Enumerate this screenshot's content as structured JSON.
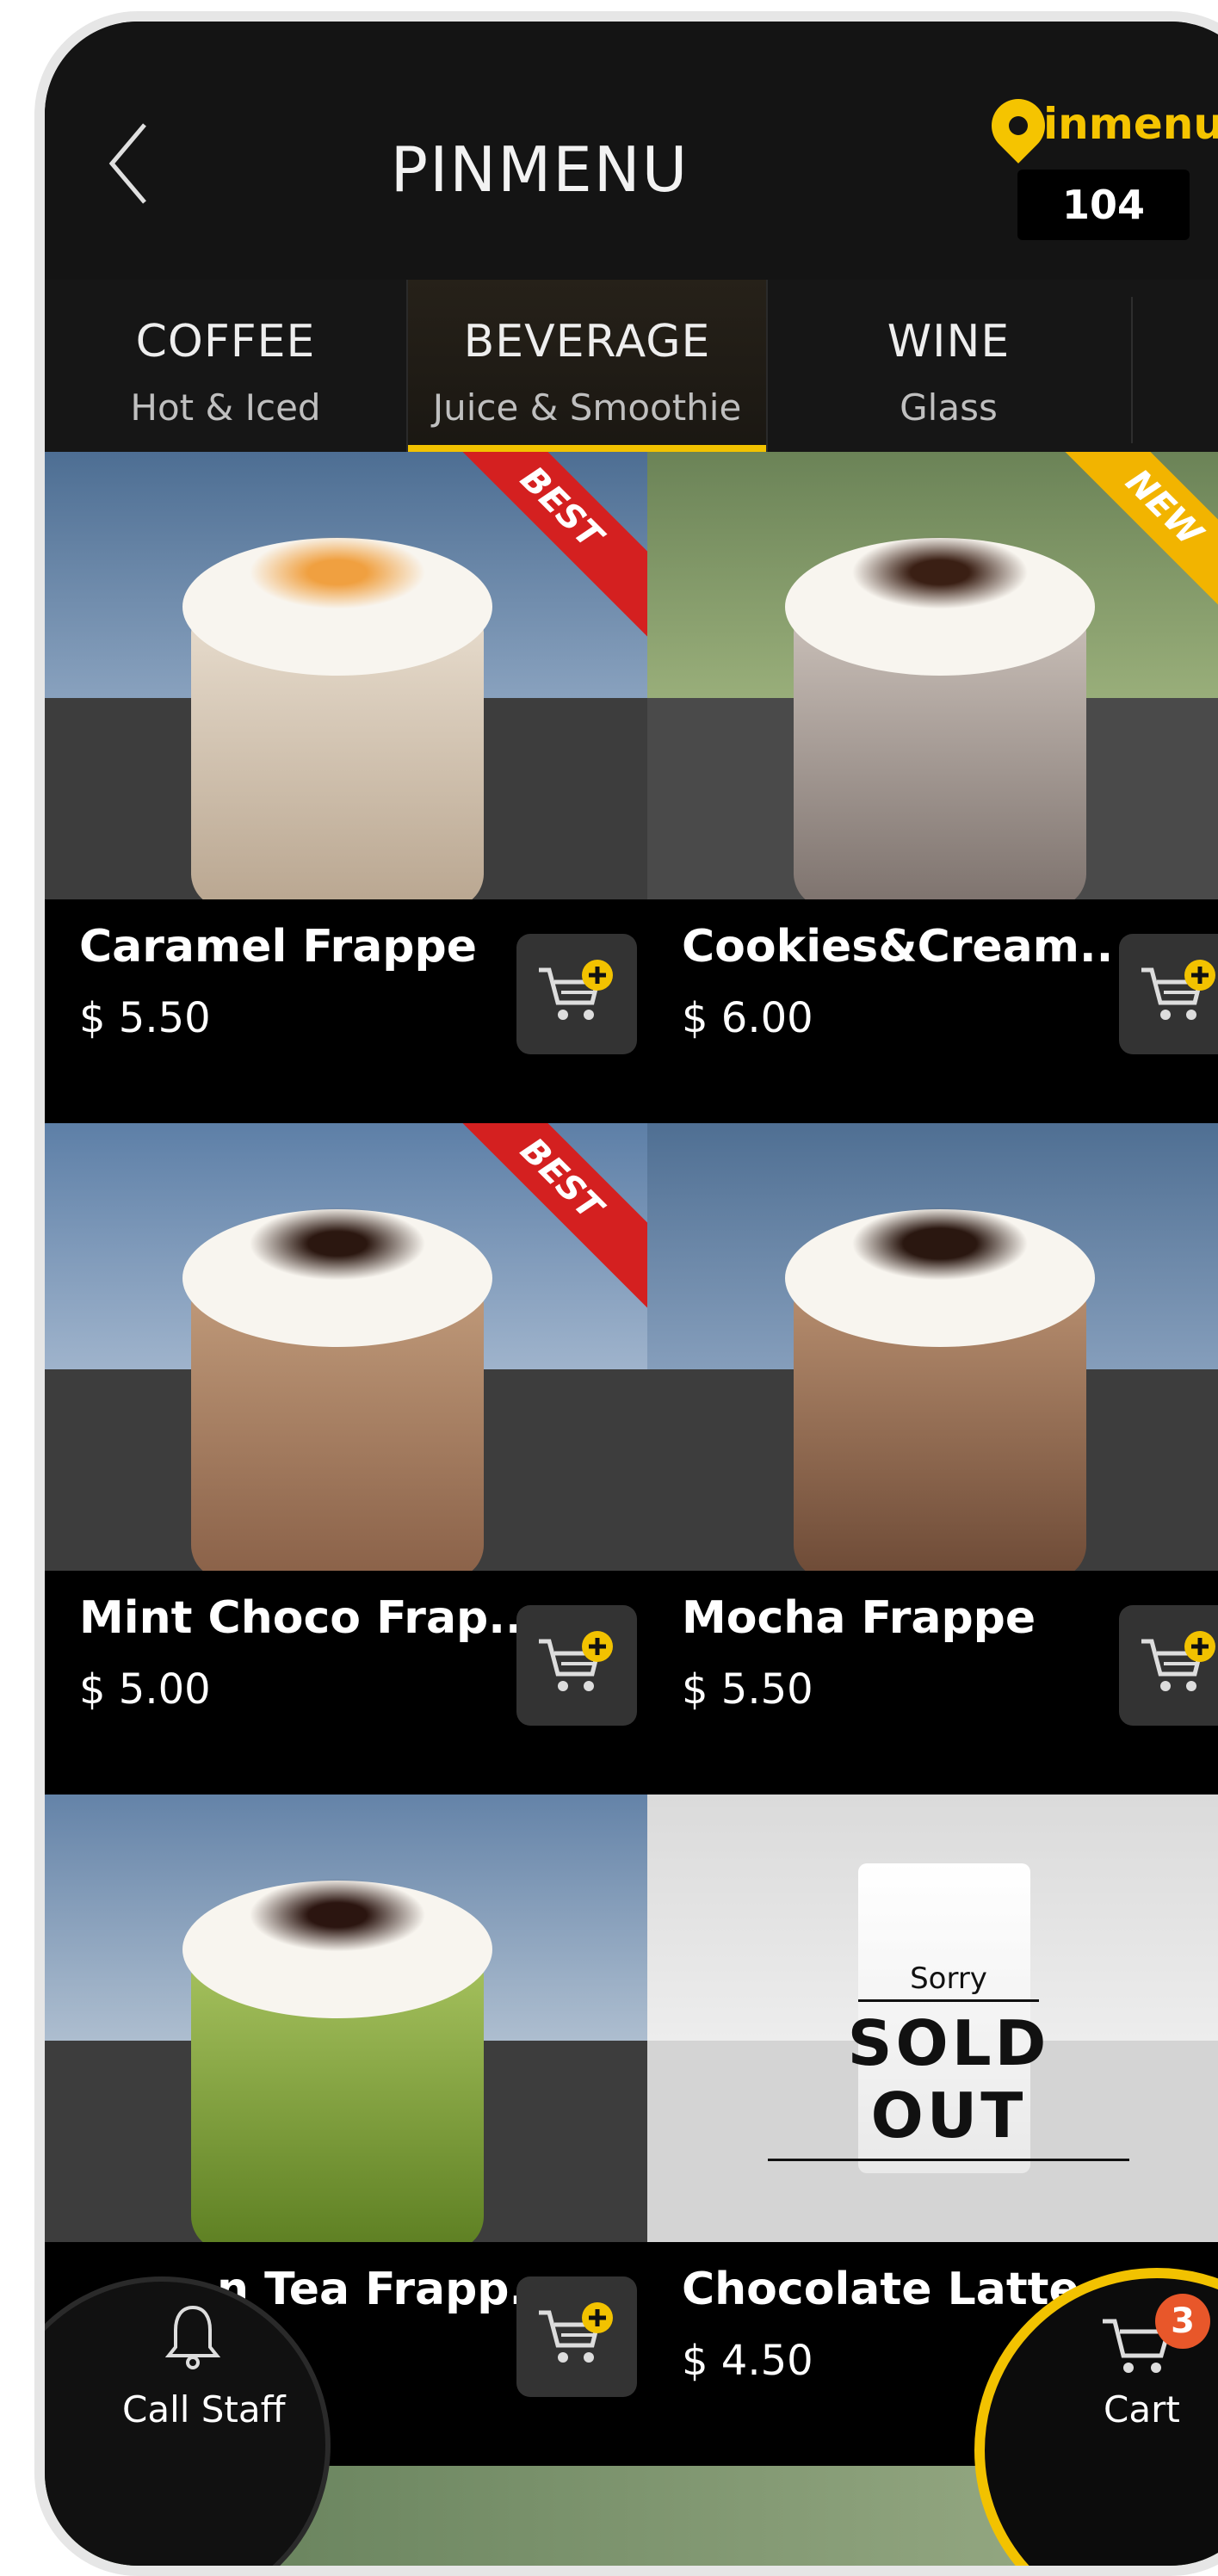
{
  "header": {
    "title": "PINMENU",
    "logo_text": "inmenu",
    "table_number": "104"
  },
  "tabs": [
    {
      "label": "COFFEE",
      "sub": "Hot & Iced"
    },
    {
      "label": "BEVERAGE",
      "sub": "Juice & Smoothie"
    },
    {
      "label": "WINE",
      "sub": "Glass"
    }
  ],
  "items": [
    {
      "name": "Caramel Frappe",
      "price": "$ 5.50",
      "badge": "BEST",
      "badge_color": "#d42020"
    },
    {
      "name": "Cookies&Cream..",
      "price": "$ 6.00",
      "badge": "NEW",
      "badge_color": "#f2b400"
    },
    {
      "name": "Mint Choco Frap..",
      "price": "$ 5.00",
      "badge": "BEST",
      "badge_color": "#d42020"
    },
    {
      "name": "Mocha Frappe",
      "price": "$ 5.50",
      "badge": ""
    },
    {
      "name": "Green Tea Frapp..",
      "visible_name": "n Tea Frapp..",
      "price": ""
    },
    {
      "name": "Chocolate Latte",
      "price": "$ 4.50",
      "sold_out_sorry": "Sorry",
      "sold_out": "SOLD OUT"
    }
  ],
  "fab": {
    "call_staff": "Call Staff",
    "cart": "Cart",
    "cart_count": "3"
  },
  "colors": {
    "accent": "#f2c200",
    "background": "#0c0c0c",
    "badge": "#e8572a"
  }
}
